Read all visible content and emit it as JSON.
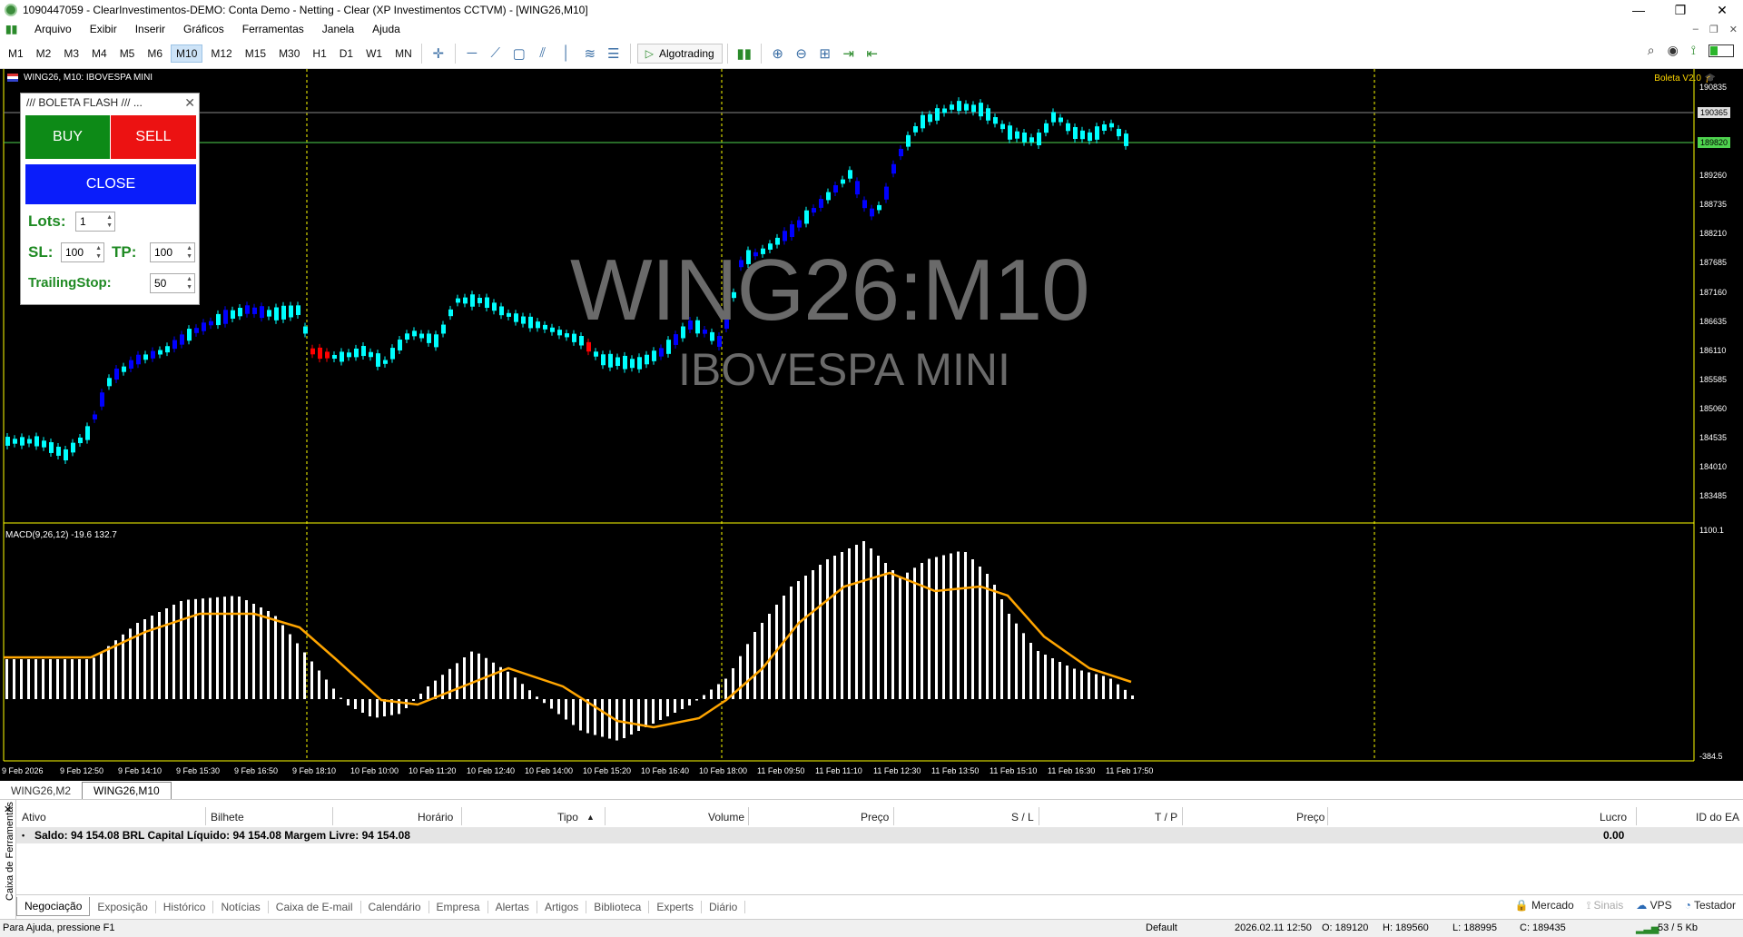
{
  "window": {
    "title": "1090447059 - ClearInvestimentos-DEMO: Conta Demo - Netting - Clear (XP Investimentos CCTVM) - [WING26,M10]"
  },
  "menu": [
    "Arquivo",
    "Exibir",
    "Inserir",
    "Gráficos",
    "Ferramentas",
    "Janela",
    "Ajuda"
  ],
  "timeframes": [
    "M1",
    "M2",
    "M3",
    "M4",
    "M5",
    "M6",
    "M10",
    "M12",
    "M15",
    "M30",
    "H1",
    "D1",
    "W1",
    "MN"
  ],
  "active_timeframe": "M10",
  "toolbar": {
    "algotrading_label": "Algotrading"
  },
  "chart": {
    "header": "WING26, M10:  IBOVESPA MINI",
    "ea_label": "Boleta V2.0",
    "watermark_symbol": "WING26:M10",
    "watermark_desc": "IBOVESPA MINI",
    "price_axis": [
      "190835",
      "189260",
      "188735",
      "188210",
      "187685",
      "187160",
      "186635",
      "186110",
      "185585",
      "185060",
      "184535",
      "184010",
      "183485"
    ],
    "price_tag_grey": "190365",
    "price_tag_green": "189820",
    "macd_label": "MACD(9,26,12) -19.6 132.7",
    "macd_axis": [
      "1100.1",
      "-384.5"
    ],
    "time_axis": [
      "9 Feb 2026",
      "9 Feb 12:50",
      "9 Feb 14:10",
      "9 Feb 15:30",
      "9 Feb 16:50",
      "9 Feb 18:10",
      "10 Feb 10:00",
      "10 Feb 11:20",
      "10 Feb 12:40",
      "10 Feb 14:00",
      "10 Feb 15:20",
      "10 Feb 16:40",
      "10 Feb 18:00",
      "11 Feb 09:50",
      "11 Feb 11:10",
      "11 Feb 12:30",
      "11 Feb 13:50",
      "11 Feb 15:10",
      "11 Feb 16:30",
      "11 Feb 17:50"
    ],
    "colors": {
      "bull": "#00ffff",
      "bear_old": "#0000ff",
      "red": "#ff0000",
      "signal": "#ffa500",
      "hist": "#ffffff",
      "sep": "#ffff00"
    }
  },
  "boleta": {
    "title": "///    BOLETA FLASH    /// ...",
    "buy": "BUY",
    "sell": "SELL",
    "close": "CLOSE",
    "lots_label": "Lots:",
    "lots_value": "1",
    "sl_label": "SL:",
    "sl_value": "100",
    "tp_label": "TP:",
    "tp_value": "100",
    "trailing_label": "TrailingStop:",
    "trailing_value": "50"
  },
  "chart_tabs": [
    "WING26,M2",
    "WING26,M10"
  ],
  "toolbox": {
    "side_label": "Caixa de Ferramentas",
    "columns": [
      "Ativo",
      "Bilhete",
      "Horário",
      "Tipo",
      "Volume",
      "Preço",
      "S / L",
      "T / P",
      "Preço",
      "Lucro",
      "ID do EA"
    ],
    "balance_text": "Saldo: 94 154.08 BRL  Capital Líquido: 94 154.08  Margem Livre: 94 154.08",
    "profit": "0.00",
    "tabs": [
      "Negociação",
      "Exposição",
      "Histórico",
      "Notícias",
      "Caixa de E-mail",
      "Calendário",
      "Empresa",
      "Alertas",
      "Artigos",
      "Biblioteca",
      "Experts",
      "Diário"
    ],
    "right": [
      "Mercado",
      "Sinais",
      "VPS",
      "Testador"
    ]
  },
  "status": {
    "help": "Para Ajuda, pressione F1",
    "profile": "Default",
    "datetime": "2026.02.11 12:50",
    "open": "O: 189120",
    "high": "H: 189560",
    "low": "L: 188995",
    "close": "C: 189435",
    "traffic": "53 / 5 Kb"
  }
}
